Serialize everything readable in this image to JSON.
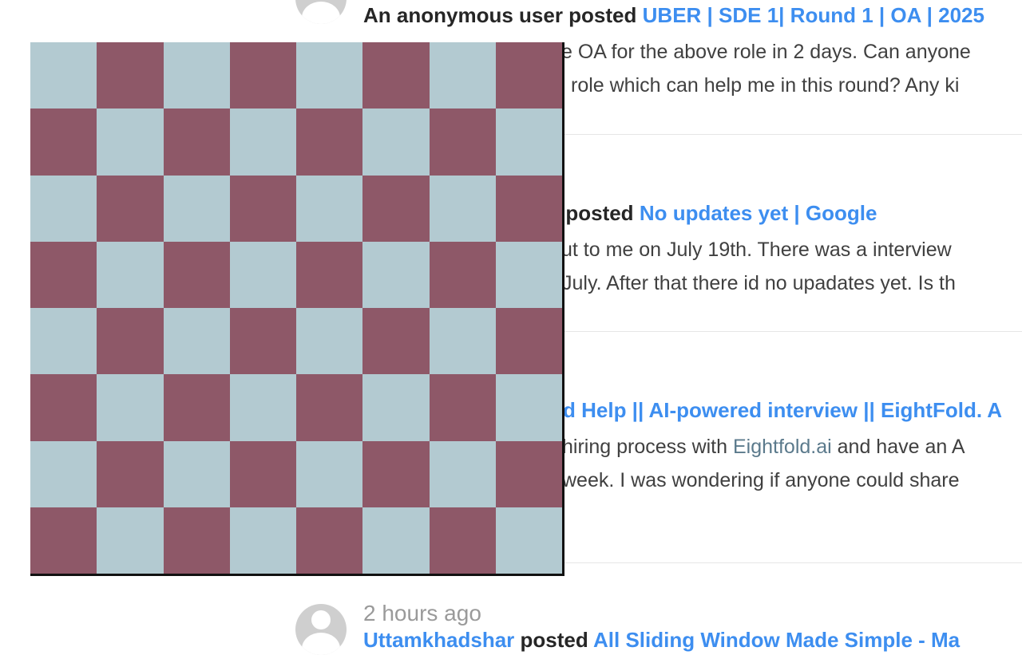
{
  "colors": {
    "light_square": "#b3cad1",
    "dark_square": "#8e5868",
    "link_blue": "#3d8ef0",
    "muted": "#9a9a9a",
    "divider": "#e6e6e6"
  },
  "board": {
    "rows": 8,
    "cols": 8
  },
  "posts": [
    {
      "time": "",
      "author": "An anonymous user",
      "verb": "posted",
      "title": "UBER | SDE 1| Round 1 | OA | 2025",
      "line1": "e OA for the above role in 2 days. Can anyone",
      "line1_mention": "",
      "line1_after": "",
      "line2": "role which can help me in this round? Any ki"
    },
    {
      "time": "",
      "author": "",
      "verb": "r posted",
      "title": "No updates yet | Google",
      "line1": "ut to me on July 19th. There was a interview",
      "line1_mention": "",
      "line1_after": "",
      "line2": "July. After that there id no upadates yet. Is th"
    },
    {
      "time": "",
      "author": "",
      "verb": "",
      "title": "d Help || AI-powered interview || EightFold. A",
      "line1": "hiring process with ",
      "line1_mention": "Eightfold.ai",
      "line1_after": " and have an A",
      "line2": "week. I was wondering if anyone could share"
    },
    {
      "time": "2 hours ago",
      "author": "Uttamkhadshar",
      "verb": "posted",
      "title": "All Sliding Window Made Simple - Ma"
    }
  ]
}
